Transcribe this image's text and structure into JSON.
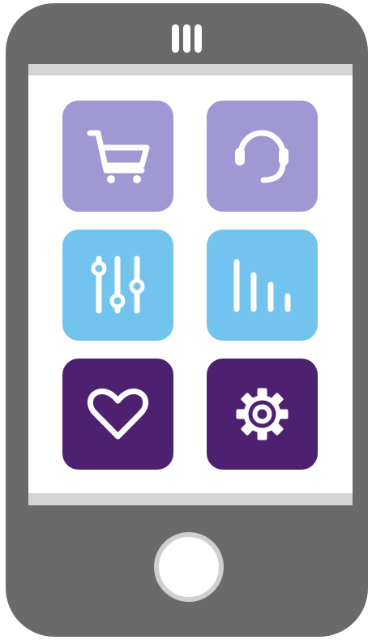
{
  "colors": {
    "phone_body": "#6a6a6a",
    "speaker": "#ffffff",
    "screen_bezel": "#d5d5d5",
    "screen": "#ffffff",
    "home_button": "#ffffff",
    "home_button_ring": "#cfcfcf",
    "icon_stroke": "#ffffff"
  },
  "apps": [
    {
      "icon": "shopping-cart-icon",
      "color": "#9f98d3"
    },
    {
      "icon": "headset-icon",
      "color": "#9f98d3"
    },
    {
      "icon": "equalizer-sliders-icon",
      "color": "#72c4ee"
    },
    {
      "icon": "bar-chart-icon",
      "color": "#72c4ee"
    },
    {
      "icon": "heart-icon",
      "color": "#4e2170"
    },
    {
      "icon": "gear-icon",
      "color": "#4e2170"
    }
  ]
}
